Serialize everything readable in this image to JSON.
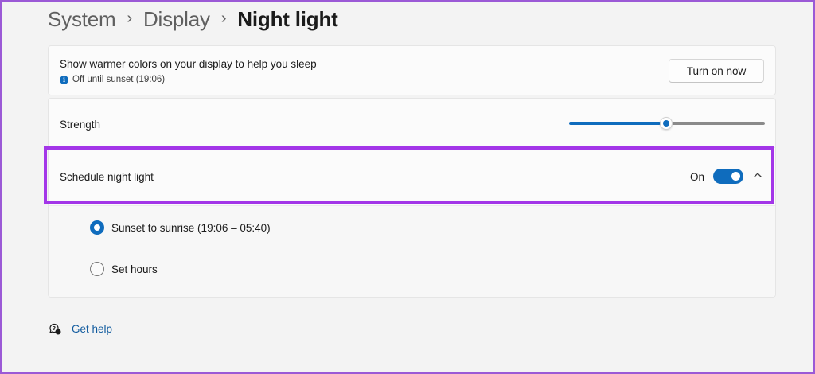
{
  "breadcrumb": {
    "items": [
      "System",
      "Display"
    ],
    "current": "Night light"
  },
  "night_light": {
    "description": "Show warmer colors on your display to help you sleep",
    "status": "Off until sunset (19:06)",
    "turn_on_label": "Turn on now"
  },
  "strength": {
    "label": "Strength",
    "value_percent": 48
  },
  "schedule": {
    "label": "Schedule night light",
    "toggle_state_label": "On",
    "toggle_on": true,
    "expanded": true,
    "options": [
      {
        "label": "Sunset to sunrise (19:06 – 05:40)",
        "selected": true
      },
      {
        "label": "Set hours",
        "selected": false
      }
    ]
  },
  "help": {
    "label": "Get help"
  },
  "colors": {
    "accent": "#0f6cbd",
    "highlight": "#a336e8"
  }
}
